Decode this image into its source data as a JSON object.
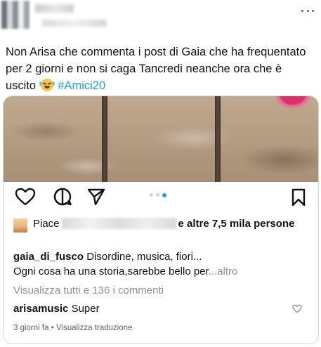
{
  "tweet": {
    "text_part1": "Non Arisa che commenta i post di Gaia che ha frequentato per 2 giorni e non si caga Tancredi neanche ora che è uscito ",
    "emoji_icon": "tears-of-joy-emoji",
    "hashtag": "#Amici20"
  },
  "instagram": {
    "likes": {
      "prefix": "Piace",
      "suffix": "e altre 7,5 mila persone"
    },
    "caption": {
      "username": "gaia_di_fusco",
      "line1": "Disordine, musica, fiori...",
      "line2": "Ogni cosa ha una storia,sarebbe bello per",
      "more": "...altro"
    },
    "view_comments": "Visualizza tutti e 136 i commenti",
    "comment": {
      "username": "arisamusic",
      "text": "Super"
    },
    "footer": {
      "time": "3 giorni fa",
      "separator": " • ",
      "translate": "Visualizza traduzione"
    },
    "carousel": {
      "total": 3,
      "active_index": 3
    }
  },
  "colors": {
    "link": "#1d9bf0",
    "text": "#0f1419",
    "muted": "#8a9399",
    "border": "#cfd9de"
  }
}
